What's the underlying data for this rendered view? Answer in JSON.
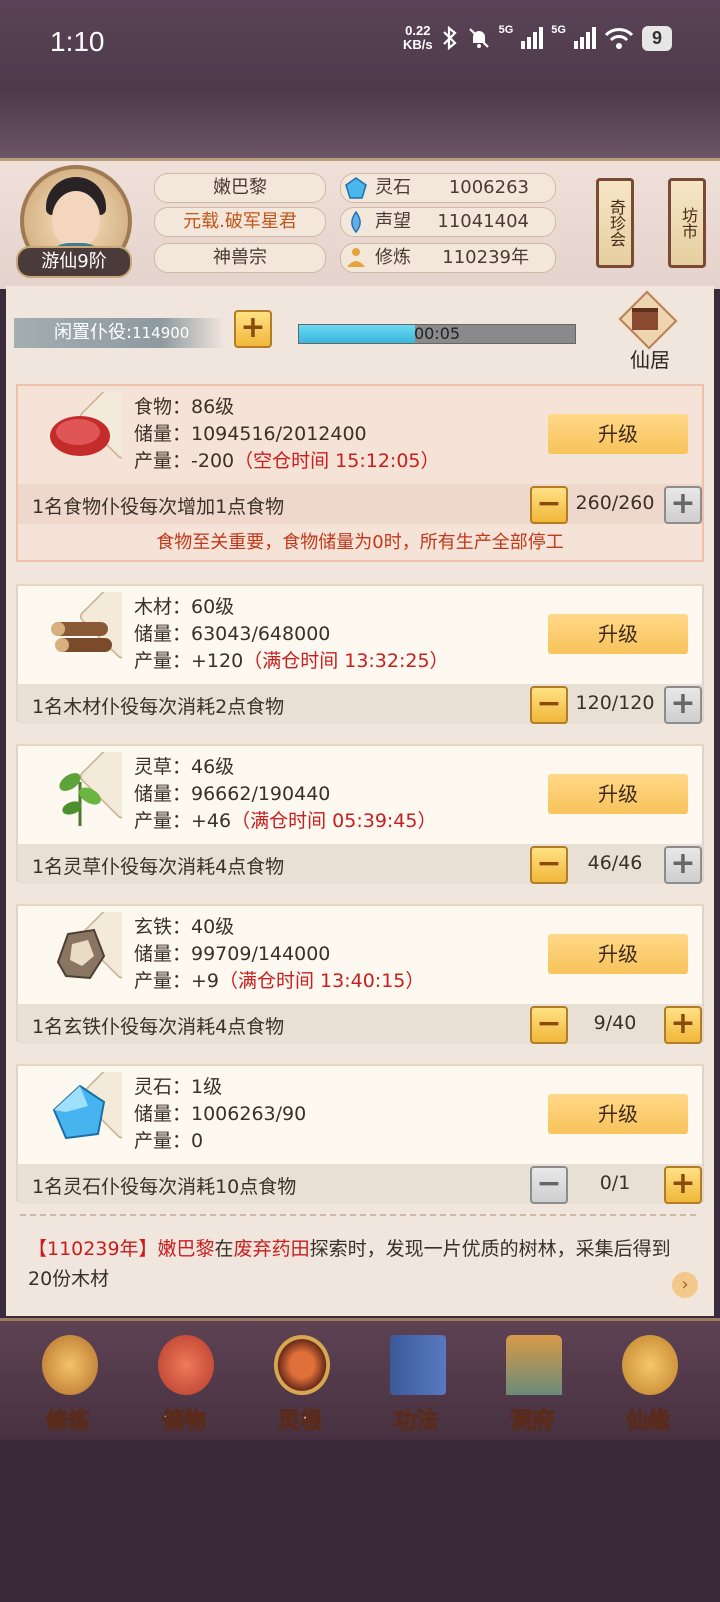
{
  "status_bar": {
    "time": "1:10",
    "speed_value": "0.22",
    "speed_unit": "KB/s",
    "net1": "5G",
    "net2": "5G",
    "battery": "9"
  },
  "player": {
    "name": "嫩巴黎",
    "title": "元载.破军星君",
    "sect": "神兽宗",
    "rank": "游仙9阶"
  },
  "resources": [
    {
      "icon": "spirit-stone-icon",
      "label": "灵石",
      "value": "1006263"
    },
    {
      "icon": "reputation-icon",
      "label": "声望",
      "value": "11041404"
    },
    {
      "icon": "cultivation-icon",
      "label": "修炼",
      "value": "110239年"
    }
  ],
  "shops": [
    {
      "label": "奇珍会"
    },
    {
      "label": "坊市"
    }
  ],
  "idle_workers": {
    "label": "闲置仆役:",
    "value": "114900"
  },
  "timer": {
    "text": "00:05",
    "progress": 0.42
  },
  "xianju": {
    "label": "仙居"
  },
  "production": [
    {
      "key": "food",
      "icon": "meat-icon",
      "level_text": "食物：86级",
      "storage_text": "储量：1094516/2012400",
      "output_prefix": "产量：-200",
      "output_status": "（空仓时间 15:12:05）",
      "upgrade_label": "升级",
      "worker_desc": "1名食物仆役每次增加1点食物",
      "worker_count": "260/260",
      "minus_enabled": true,
      "plus_enabled": true,
      "warning": "食物至关重要，食物储量为0时，所有生产全部停工"
    },
    {
      "key": "wood",
      "icon": "wood-logs-icon",
      "level_text": "木材：60级",
      "storage_text": "储量：63043/648000",
      "output_prefix": "产量：+120",
      "output_status": "（满仓时间 13:32:25）",
      "upgrade_label": "升级",
      "worker_desc": "1名木材仆役每次消耗2点食物",
      "worker_count": "120/120",
      "minus_enabled": true,
      "plus_enabled": true
    },
    {
      "key": "herb",
      "icon": "herb-icon",
      "level_text": "灵草：46级",
      "storage_text": "储量：96662/190440",
      "output_prefix": "产量：+46",
      "output_status": "（满仓时间 05:39:45）",
      "upgrade_label": "升级",
      "worker_desc": "1名灵草仆役每次消耗4点食物",
      "worker_count": "46/46",
      "minus_enabled": true,
      "plus_enabled": true
    },
    {
      "key": "iron",
      "icon": "iron-ore-icon",
      "level_text": "玄铁：40级",
      "storage_text": "储量：99709/144000",
      "output_prefix": "产量：+9",
      "output_status": "（满仓时间 13:40:15）",
      "upgrade_label": "升级",
      "worker_desc": "1名玄铁仆役每次消耗4点食物",
      "worker_count": "9/40",
      "minus_enabled": true,
      "plus_enabled": true
    },
    {
      "key": "stone",
      "icon": "crystal-icon",
      "level_text": "灵石：1级",
      "storage_text": "储量：1006263/90",
      "output_prefix": "产量：0",
      "output_status": "",
      "upgrade_label": "升级",
      "worker_desc": "1名灵石仆役每次消耗10点食物",
      "worker_count": "0/1",
      "minus_enabled": false,
      "plus_enabled": true
    }
  ],
  "log": {
    "year": "【110239年】",
    "name": "嫩巴黎",
    "text1": "在",
    "place": "废弃药田",
    "text2": "探索时，发现一片优质的树林，采集后得到20份木材"
  },
  "nav": [
    {
      "label": "修炼",
      "icon": "cultivate-icon"
    },
    {
      "label": "储物",
      "icon": "storage-bag-icon"
    },
    {
      "label": "灵根",
      "icon": "spirit-root-icon"
    },
    {
      "label": "功法",
      "icon": "technique-book-icon"
    },
    {
      "label": "洞府",
      "icon": "cave-mansion-icon"
    },
    {
      "label": "仙缘",
      "icon": "gourd-icon"
    }
  ],
  "colors": {
    "accent_red": "#c81e1e",
    "button_gold": "#f7c35a",
    "progress_blue": "#3ab7dc"
  }
}
